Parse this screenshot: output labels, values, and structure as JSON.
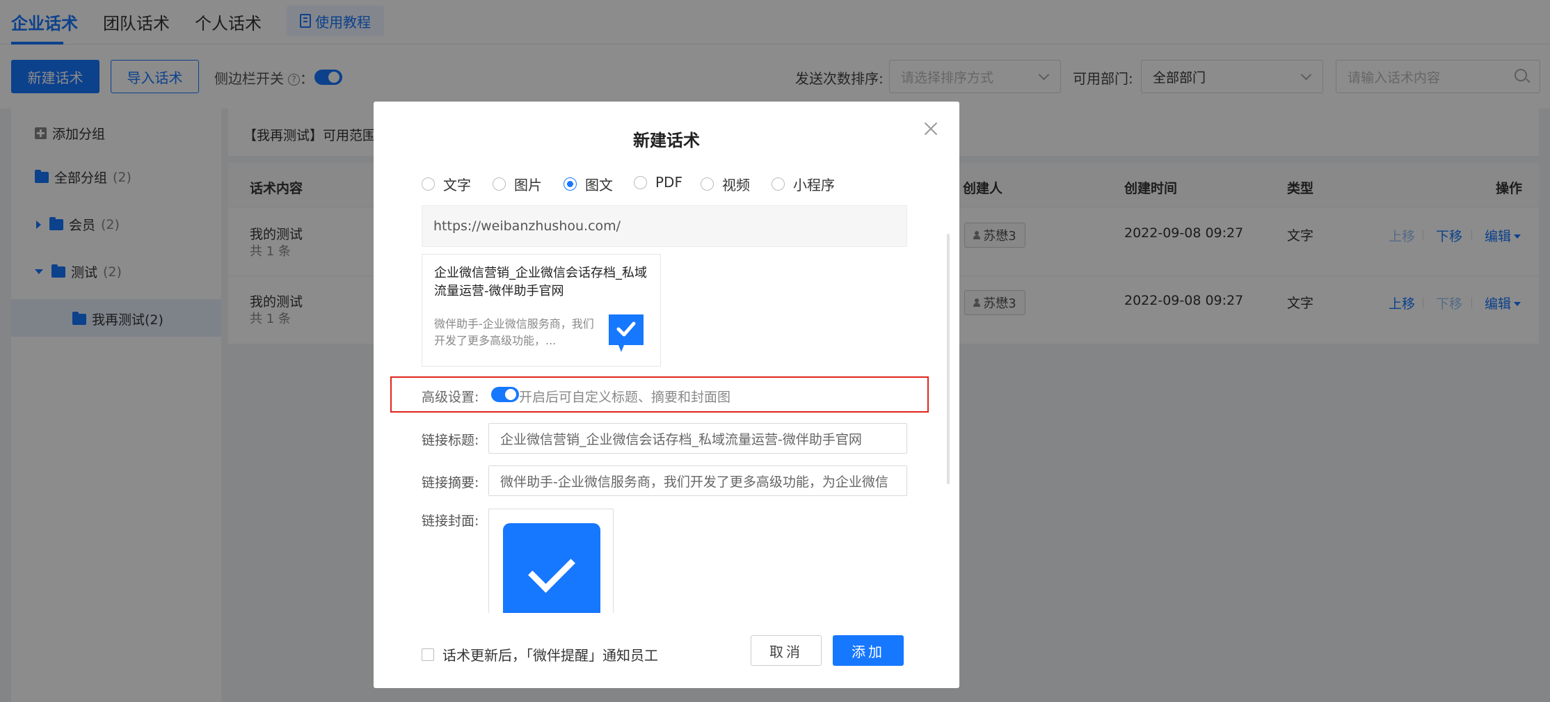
{
  "tabs": [
    {
      "label": "企业话术",
      "active": true
    },
    {
      "label": "团队话术",
      "active": false
    },
    {
      "label": "个人话术",
      "active": false
    }
  ],
  "tutorial_label": "使用教程",
  "toolbar": {
    "new_label": "新建话术",
    "import_label": "导入话术",
    "sidebar_switch_label": "侧边栏开关",
    "help_glyph": "?",
    "colon": "：",
    "sort_label": "发送次数排序:",
    "sort_placeholder": "请选择排序方式",
    "dept_label": "可用部门:",
    "dept_value": "全部部门",
    "search_placeholder": "请输入话术内容"
  },
  "sidebar": {
    "add_group": "添加分组",
    "all_groups": {
      "label": "全部分组",
      "count": "(2)"
    },
    "member": {
      "label": "会员",
      "count": "(2)"
    },
    "test": {
      "label": "测试",
      "count": "(2)"
    },
    "retest": {
      "label": "我再测试(2)"
    }
  },
  "main": {
    "scope_text": "【我再测试】可用范围"
  },
  "table": {
    "headers": {
      "content": "话术内容",
      "creator": "创建人",
      "created": "创建时间",
      "type": "类型",
      "ops": "操作"
    },
    "rows": [
      {
        "title": "我的测试",
        "sub": "共 1 条",
        "creator": "苏懋3",
        "created": "2022-09-08 09:27",
        "type": "文字",
        "up": "上移",
        "down": "下移",
        "edit": "编辑"
      },
      {
        "title": "我的测试",
        "sub": "共 1 条",
        "creator": "苏懋3",
        "created": "2022-09-08 09:27",
        "type": "文字",
        "up": "上移",
        "down": "下移",
        "edit": "编辑"
      }
    ]
  },
  "modal": {
    "title": "新建话术",
    "types": [
      {
        "label": "文字",
        "checked": false
      },
      {
        "label": "图片",
        "checked": false
      },
      {
        "label": "图文",
        "checked": true
      },
      {
        "label": "PDF",
        "checked": false
      },
      {
        "label": "视频",
        "checked": false
      },
      {
        "label": "小程序",
        "checked": false
      }
    ],
    "url": "https://weibanzhushou.com/",
    "preview": {
      "title": "企业微信营销_企业微信会话存档_私域流量运营-微伴助手官网",
      "desc": "微伴助手-企业微信服务商，我们开发了更多高级功能，..."
    },
    "advanced": {
      "label": "高级设置:",
      "enabled": true,
      "hint": "开启后可自定义标题、摘要和封面图"
    },
    "link_title_label": "链接标题:",
    "link_title_value": "企业微信营销_企业微信会话存档_私域流量运营-微伴助手官网",
    "link_summary_label": "链接摘要:",
    "link_summary_value": "微伴助手-企业微信服务商，我们开发了更多高级功能，为企业微信",
    "link_cover_label": "链接封面:",
    "notify_label": "话术更新后，「微伴提醒」通知员工",
    "cancel_label": "取消",
    "add_label": "添加"
  },
  "colors": {
    "accent": "#1677ff",
    "highlight_border": "#e0241b"
  }
}
